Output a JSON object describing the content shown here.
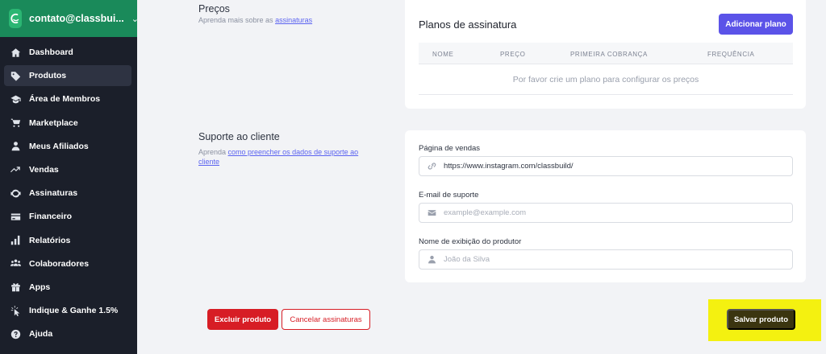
{
  "sidebar": {
    "account": {
      "email": "contato@classbui...",
      "logo_icon": "classbuild-logo-icon",
      "chevron_icon": "chevron-down-icon"
    },
    "items": [
      {
        "label": "Dashboard",
        "icon": "home-icon",
        "active": false
      },
      {
        "label": "Produtos",
        "icon": "tag-icon",
        "active": true
      },
      {
        "label": "Área de Membros",
        "icon": "graduation-cap-icon",
        "active": false
      },
      {
        "label": "Marketplace",
        "icon": "cart-icon",
        "active": false
      },
      {
        "label": "Meus Afiliados",
        "icon": "user-icon",
        "active": false
      },
      {
        "label": "Vendas",
        "icon": "trend-icon",
        "active": false
      },
      {
        "label": "Assinaturas",
        "icon": "refresh-icon",
        "active": false
      },
      {
        "label": "Financeiro",
        "icon": "card-icon",
        "active": false
      },
      {
        "label": "Relatórios",
        "icon": "bar-chart-icon",
        "active": false
      },
      {
        "label": "Colaboradores",
        "icon": "users-icon",
        "active": false
      },
      {
        "label": "Apps",
        "icon": "gift-icon",
        "active": false
      },
      {
        "label": "Indique & Ganhe 1.5%",
        "icon": "pointer-icon",
        "active": false
      },
      {
        "label": "Ajuda",
        "icon": "help-icon",
        "active": false
      }
    ]
  },
  "pricing": {
    "title": "Preços",
    "desc_prefix": "Aprenda mais sobre as ",
    "desc_link": "assinaturas",
    "card_title": "Planos de assinatura",
    "add_button": "Adicionar plano",
    "columns": [
      "NOME",
      "PREÇO",
      "PRIMEIRA COBRANÇA",
      "FREQUÊNCIA"
    ],
    "empty_message": "Por favor crie um plano para configurar os preços"
  },
  "support": {
    "title": "Suporte ao cliente",
    "desc_prefix": "Aprenda ",
    "desc_link": "como preencher os dados de suporte ao cliente",
    "sales_page_label": "Página de vendas",
    "sales_page_value": "https://www.instagram.com/classbuild/",
    "email_label": "E-mail de suporte",
    "email_placeholder": "example@example.com",
    "producer_label": "Nome de exibição do produtor",
    "producer_placeholder": "João da Silva"
  },
  "actions": {
    "delete": "Excluir produto",
    "cancel_subscriptions": "Cancelar assinaturas",
    "save": "Salvar produto"
  },
  "colors": {
    "sidebar_bg": "#1b1f2a",
    "account_bg": "#1a8a5a",
    "primary": "#5b53e8",
    "danger": "#d71d25",
    "highlight": "#f4f110",
    "save_bg": "#3b3510"
  }
}
